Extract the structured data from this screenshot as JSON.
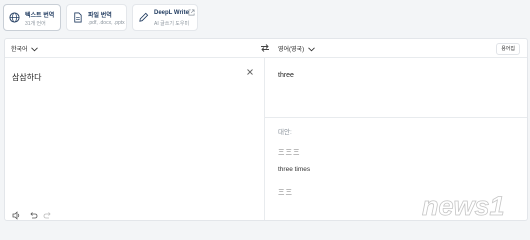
{
  "tabs": [
    {
      "title": "텍스트 번역",
      "subtitle": "31개 언어"
    },
    {
      "title": "파일 번역",
      "subtitle": ".pdf, .docx, .pptx"
    },
    {
      "title": "DeepL Write",
      "subtitle": "AI 글쓰기 도우미"
    }
  ],
  "source": {
    "language": "한국어",
    "text": "삼삼하다"
  },
  "target": {
    "language": "영어(영국)",
    "glossary_label": "용어집",
    "text": "three",
    "alternatives_label": "대안:",
    "alternatives": [
      "三三三",
      "three times",
      "三三"
    ]
  },
  "watermark": {
    "text": "news1"
  },
  "colors": {
    "accent": "#1f3a5f",
    "border": "#e3e6ea",
    "background": "#f3f5f7"
  }
}
